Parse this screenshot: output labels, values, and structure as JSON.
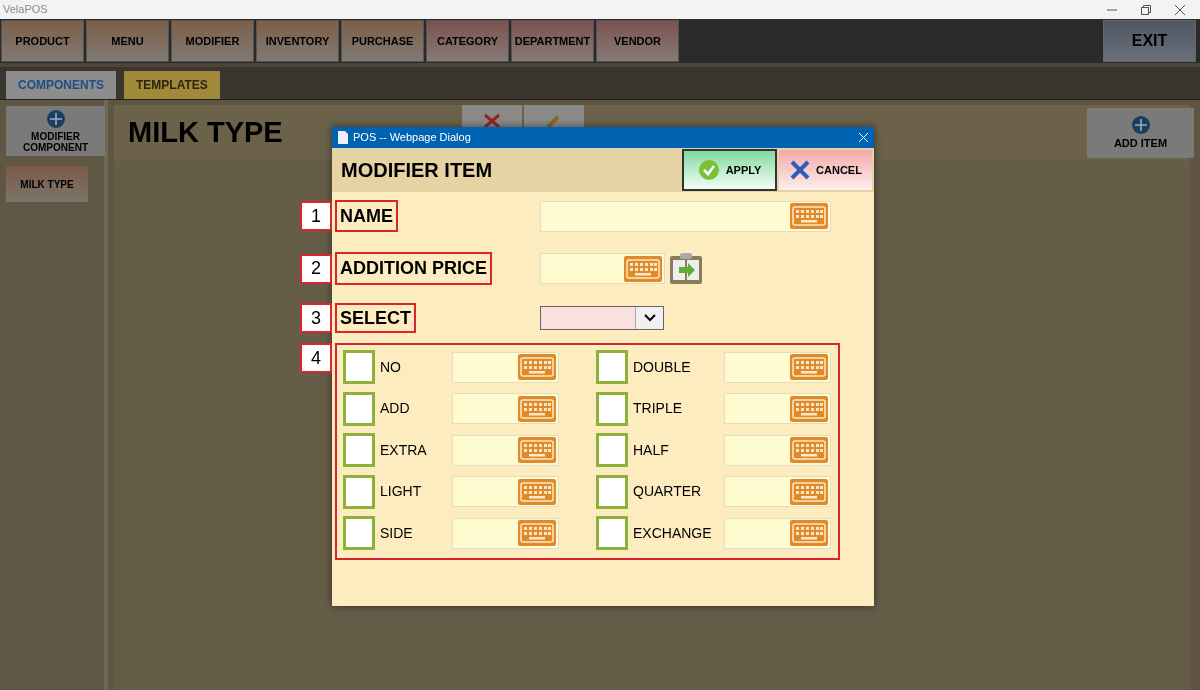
{
  "window": {
    "title": "VelaPOS"
  },
  "nav": [
    "PRODUCT",
    "MENU",
    "MODIFIER",
    "INVENTORY",
    "PURCHASE",
    "CATEGORY",
    "DEPARTMENT",
    "VENDOR"
  ],
  "exit": "EXIT",
  "tabs": [
    {
      "label": "COMPONENTS",
      "selected": true
    },
    {
      "label": "TEMPLATES",
      "selected": false
    }
  ],
  "sidebar": {
    "add_button": "MODIFIER COMPONENT",
    "items": [
      {
        "label": "MILK TYPE",
        "selected": true
      }
    ]
  },
  "page_title": "MILK TYPE",
  "add_item": "ADD ITEM",
  "dialog": {
    "title": "POS -- Webpage Dialog",
    "heading": "MODIFIER ITEM",
    "apply": "APPLY",
    "cancel": "CANCEL",
    "fields": [
      {
        "number": "1",
        "label": "NAME",
        "kind": "text"
      },
      {
        "number": "2",
        "label": "ADDITION PRICE",
        "kind": "price"
      },
      {
        "number": "3",
        "label": "SELECT",
        "kind": "select"
      }
    ],
    "options_number": "4",
    "options": [
      {
        "label": "NO",
        "checked": false
      },
      {
        "label": "ADD",
        "checked": false
      },
      {
        "label": "EXTRA",
        "checked": false
      },
      {
        "label": "LIGHT",
        "checked": false
      },
      {
        "label": "SIDE",
        "checked": false
      },
      {
        "label": "DOUBLE",
        "checked": false
      },
      {
        "label": "TRIPLE",
        "checked": false
      },
      {
        "label": "HALF",
        "checked": false
      },
      {
        "label": "QUARTER",
        "checked": false
      },
      {
        "label": "EXCHANGE",
        "checked": false
      }
    ]
  }
}
